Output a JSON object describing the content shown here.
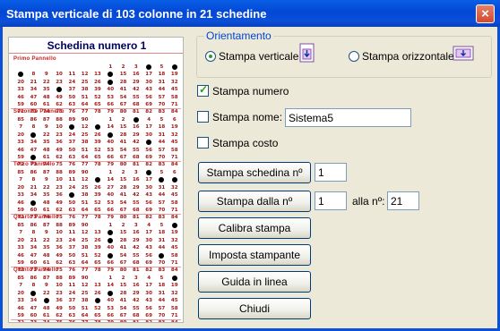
{
  "window": {
    "title": "Stampa verticale di 103 colonne in 21 schedine",
    "close_glyph": "×"
  },
  "preview": {
    "title": "Schedina numero 1",
    "panels": [
      {
        "name": "Primo Pannello",
        "dots": [
          4,
          6,
          7,
          14,
          27,
          36
        ]
      },
      {
        "name": "Secondo Pannello",
        "dots": [
          3,
          11,
          13,
          21,
          27,
          43,
          60
        ]
      },
      {
        "name": "Terzo Pannello",
        "dots": [
          4,
          13,
          18,
          19,
          37,
          47
        ]
      },
      {
        "name": "Quarto Pannello",
        "dots": [
          6,
          14,
          27,
          53,
          57
        ]
      },
      {
        "name": "Quinto Pannello",
        "dots": [
          6,
          21,
          27,
          35,
          39
        ]
      }
    ],
    "grid_rows": [
      [
        "1",
        "2",
        "3",
        "4",
        "5",
        "6"
      ],
      [
        "7",
        "8",
        "9",
        "10",
        "11",
        "12",
        "13",
        "14",
        "15",
        "16",
        "17",
        "18",
        "19"
      ],
      [
        "20",
        "21",
        "22",
        "23",
        "24",
        "25",
        "26",
        "27",
        "28",
        "29",
        "30",
        "31",
        "32"
      ],
      [
        "33",
        "34",
        "35",
        "36",
        "37",
        "38",
        "39",
        "40",
        "41",
        "42",
        "43",
        "44",
        "45"
      ],
      [
        "46",
        "47",
        "48",
        "49",
        "50",
        "51",
        "52",
        "53",
        "54",
        "55",
        "56",
        "57",
        "58"
      ],
      [
        "59",
        "60",
        "61",
        "62",
        "63",
        "64",
        "65",
        "66",
        "67",
        "68",
        "69",
        "70",
        "71"
      ],
      [
        "72",
        "73",
        "74",
        "75",
        "76",
        "77",
        "78",
        "79",
        "80",
        "81",
        "82",
        "83",
        "84"
      ],
      [
        "85",
        "86",
        "87",
        "88",
        "89",
        "90"
      ]
    ]
  },
  "orientation": {
    "legend": "Orientamento",
    "vertical_label": "Stampa verticale",
    "horizontal_label": "Stampa orizzontale",
    "selected": "vertical"
  },
  "options": {
    "print_number_label": "Stampa numero",
    "print_number_checked": true,
    "print_name_label": "Stampa nome:",
    "print_name_checked": false,
    "name_value": "Sistema5",
    "print_cost_label": "Stampa costo",
    "print_cost_checked": false
  },
  "actions": {
    "print_card_label": "Stampa schedina nº",
    "print_card_value": "1",
    "print_from_label": "Stampa dalla nº",
    "print_from_value": "1",
    "to_label": "alla nº:",
    "to_value": "21",
    "calibrate_label": "Calibra stampa",
    "printer_setup_label": "Imposta stampante",
    "help_label": "Guida in linea",
    "close_label": "Chiudi"
  }
}
